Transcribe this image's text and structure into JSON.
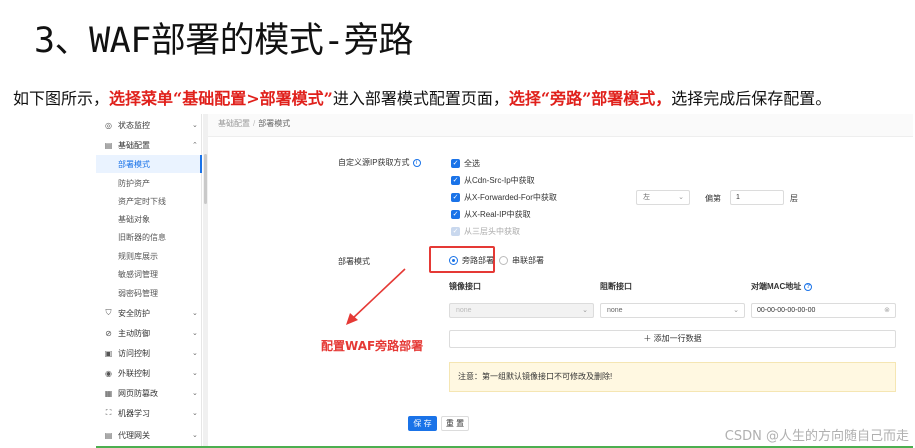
{
  "slide": {
    "title": "3、WAF部署的模式-旁路",
    "desc_a": "如下图所示，",
    "desc_b": "选择菜单“基础配置>部署模式”",
    "desc_c": "进入部署模式配置页面，",
    "desc_d": "选择“旁路”部署模式，",
    "desc_e": "选择完成后保存配置。"
  },
  "sidebar": {
    "menus_top": [
      {
        "label": "状态监控",
        "icon": "monitor-icon"
      },
      {
        "label": "基础配置",
        "icon": "config-icon"
      }
    ],
    "submenu": [
      "部署模式",
      "防护资产",
      "资产定时下线",
      "基础对象",
      "旧断器的信息",
      "规则库展示",
      "敏感词管理",
      "弱密码管理"
    ],
    "menus_bottom": [
      {
        "label": "安全防护",
        "icon": "shield-icon"
      },
      {
        "label": "主动防御",
        "icon": "defense-icon"
      },
      {
        "label": "访问控制",
        "icon": "access-icon"
      },
      {
        "label": "外联控制",
        "icon": "outbound-icon"
      },
      {
        "label": "网页防篡改",
        "icon": "tamper-icon"
      },
      {
        "label": "机器学习",
        "icon": "ml-icon"
      },
      {
        "label": "代理网关",
        "icon": "gateway-icon"
      }
    ]
  },
  "breadcrumb": {
    "parent": "基础配置",
    "current": "部署模式"
  },
  "form": {
    "ip_label": "自定义源IP获取方式",
    "options": [
      "全选",
      "从Cdn-Src-Ip中获取",
      "从X-Forwarded-For中获取",
      "从X-Real-IP中获取",
      "从三层头中获取"
    ],
    "direction_value": "左",
    "offset_label": "偏第",
    "offset_value": "1",
    "offset_unit": "层",
    "mode_label": "部署模式",
    "mode_bypass": "旁路部署",
    "mode_serial": "串联部署",
    "col_mirror": "镜像接口",
    "col_block": "阻断接口",
    "col_mac": "对端MAC地址",
    "mirror_value": "none",
    "block_value": "none",
    "mac_value": "00-00-00-00-00-00",
    "add_row": "＋ 添加一行数据",
    "notice": "注意：第一组默认镜像接口不可修改及删除!",
    "save": "保 存",
    "reset": "重 置"
  },
  "annotation": "配置WAF旁路部署",
  "watermark": "CSDN @人生的方向随自己而走"
}
